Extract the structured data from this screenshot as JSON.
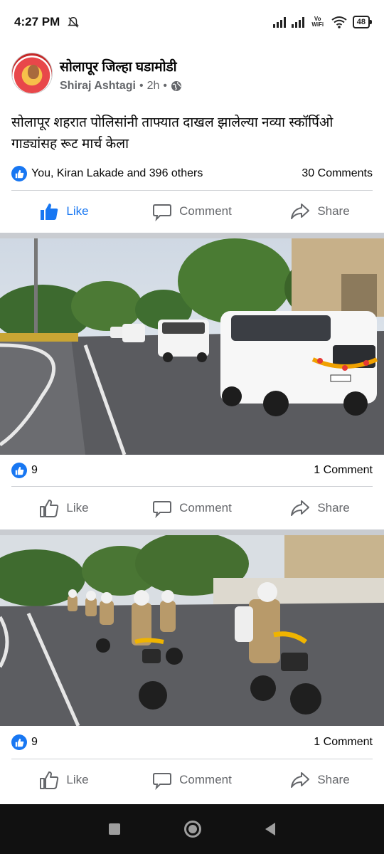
{
  "status_bar": {
    "time": "4:27 PM",
    "network_label": "Vo WiFi",
    "battery": "48"
  },
  "post": {
    "page_name": "सोलापूर जिल्हा घडामोडी",
    "author": "Shiraj Ashtagi",
    "time": "2h",
    "text": "सोलापूर शहरात पोलिसांनी  ताफ्यात दाखल झालेल्या नव्या स्कॉर्पिओ गाड्यांसह रूट मार्च केला",
    "reactions_label": "You, Kiran Lakade and 396 others",
    "comments_label": "30 Comments",
    "actions": {
      "like": "Like",
      "comment": "Comment",
      "share": "Share"
    }
  },
  "photos": [
    {
      "reactions_count": "9",
      "comments_label": "1 Comment",
      "actions": {
        "like": "Like",
        "comment": "Comment",
        "share": "Share"
      }
    },
    {
      "reactions_count": "9",
      "comments_label": "1 Comment",
      "actions": {
        "like": "Like",
        "comment": "Comment",
        "share": "Share"
      }
    }
  ],
  "colors": {
    "facebook_blue": "#1877f2",
    "secondary_text": "#65676b",
    "divider": "#ced0d4",
    "feed_background": "#c9ccd1"
  }
}
